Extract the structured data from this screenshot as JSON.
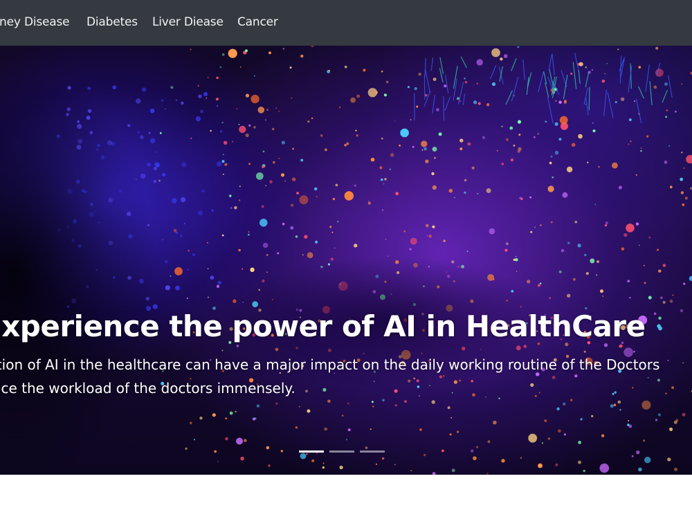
{
  "navbar": {
    "items": [
      {
        "label": "Kidney Disease"
      },
      {
        "label": "Diabetes"
      },
      {
        "label": "Liver Diease"
      },
      {
        "label": "Cancer"
      }
    ]
  },
  "hero": {
    "title": "Experience the power of AI in HealthCare",
    "text_line1": "Introduction of AI in the healthcare can have a major impact on the daily working routine of the Doctors",
    "text_line2": "and reduce the workload of the doctors immensely.",
    "slide_count": 3,
    "active_slide": 1
  }
}
